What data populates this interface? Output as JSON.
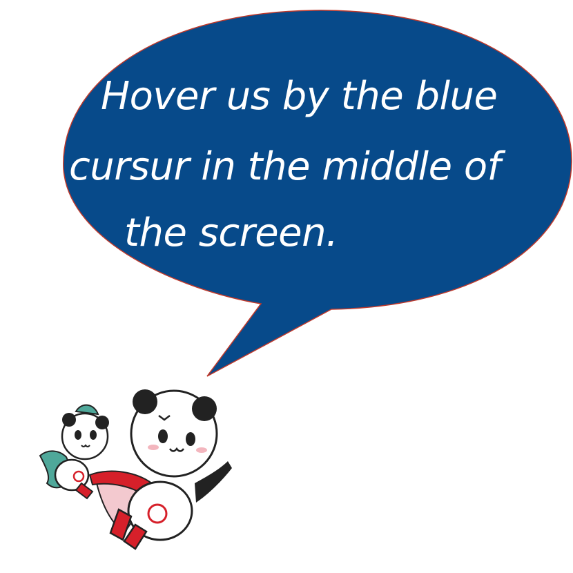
{
  "speech_bubble": {
    "lines": [
      "Hover us by the blue",
      "cursur in the middle of",
      "the screen."
    ],
    "fill_color": "#074a8a",
    "outline_color": "#c0392b",
    "text_color": "#ffffff"
  },
  "mascots": {
    "icon": "panda-mascots-flying-icon",
    "accent_red": "#d6202a",
    "accent_teal": "#4fa89a",
    "cape_pink": "#f3c9cf"
  }
}
